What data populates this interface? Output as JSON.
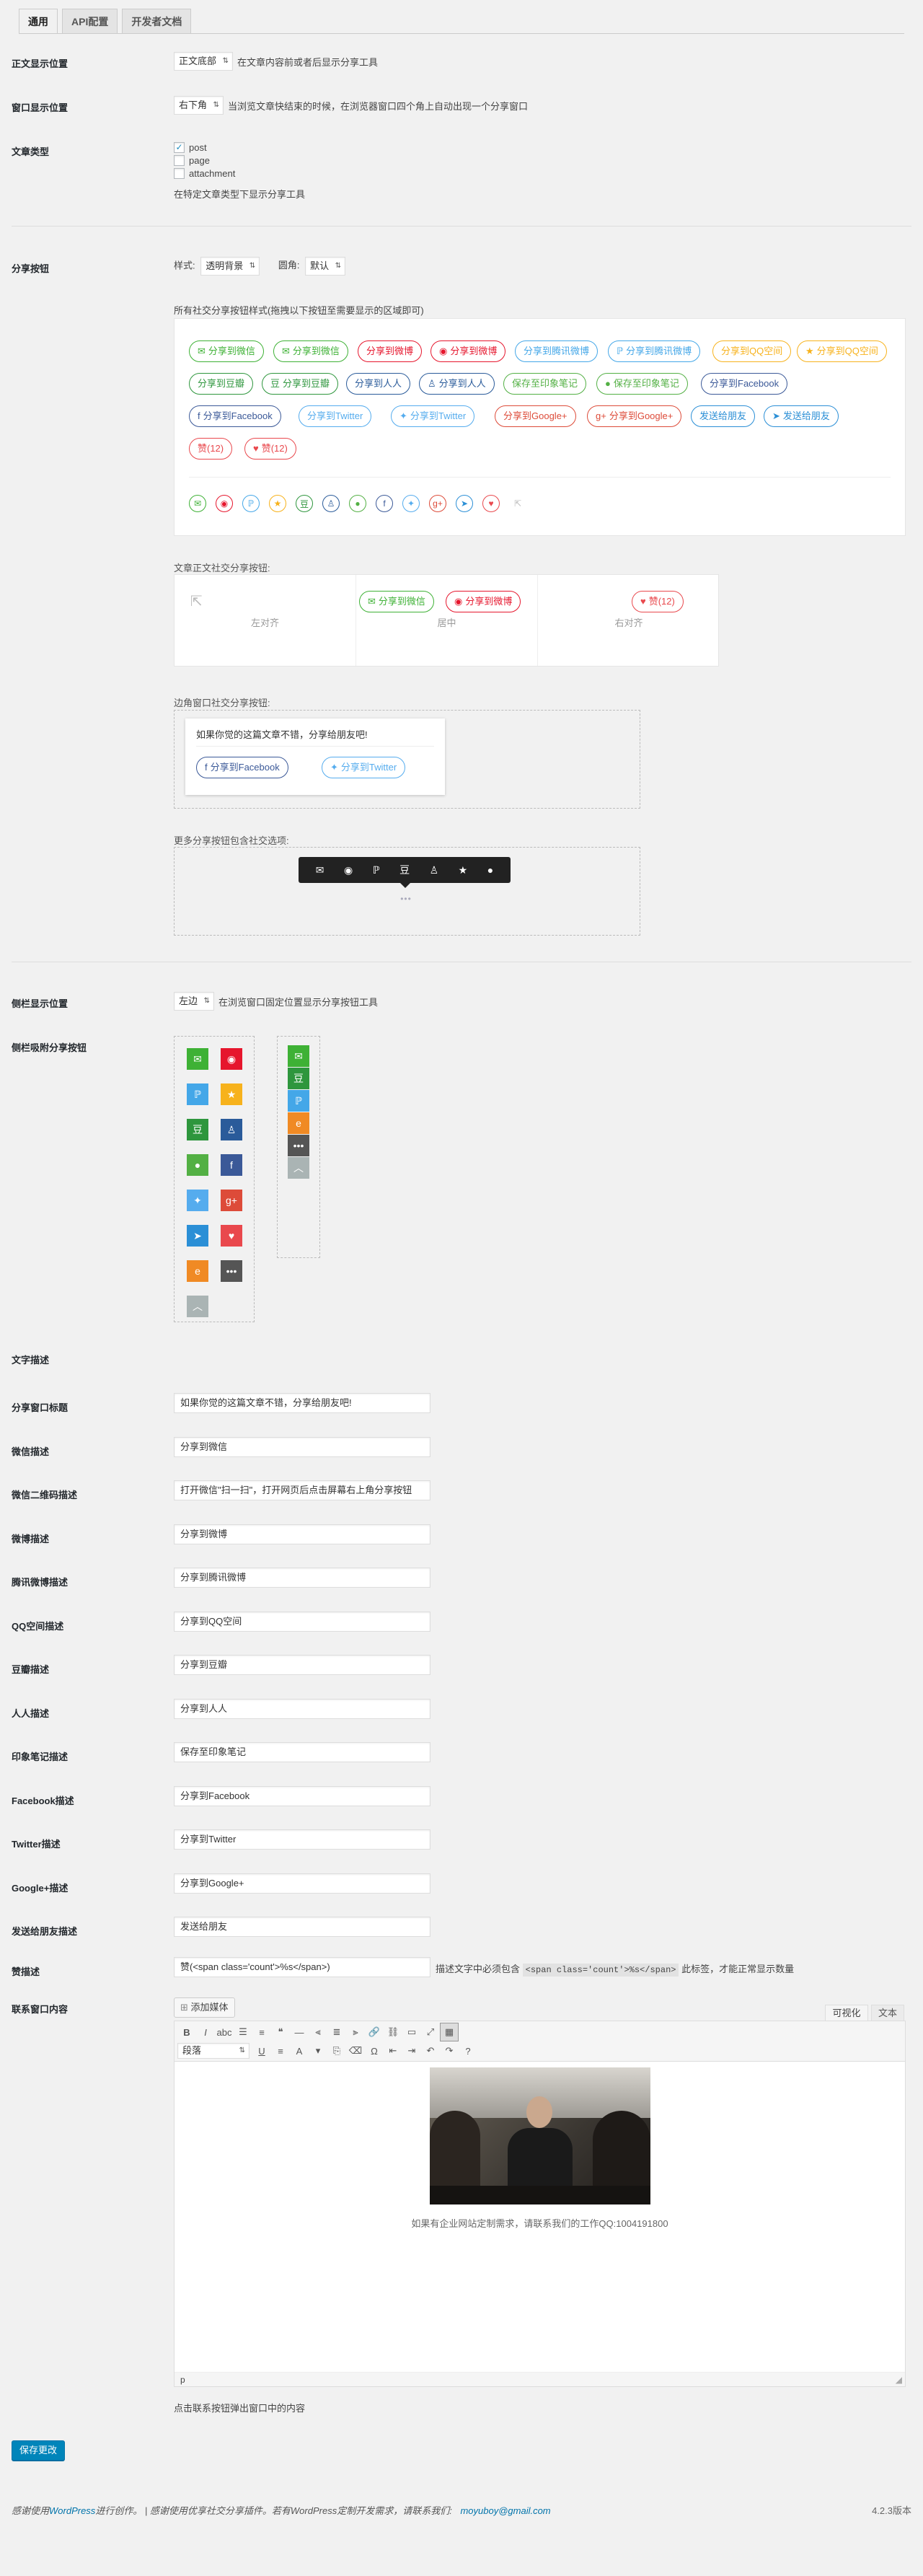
{
  "tabs": [
    "通用",
    "API配置",
    "开发者文档"
  ],
  "sections": {
    "position": {
      "label": "正文显示位置",
      "select": "正文底部",
      "hint": "在文章内容前或者后显示分享工具"
    },
    "window": {
      "label": "窗口显示位置",
      "select": "右下角",
      "hint": "当浏览文章快结束的时候，在浏览器窗口四个角上自动出现一个分享窗口"
    },
    "types": {
      "label": "文章类型",
      "items": [
        {
          "name": "post",
          "checked": "✓"
        },
        {
          "name": "page",
          "checked": ""
        },
        {
          "name": "attachment",
          "checked": ""
        }
      ],
      "hint": "在特定文章类型下显示分享工具"
    },
    "buttons": {
      "label": "分享按钮",
      "style_label": "样式:",
      "style_value": "透明背景",
      "corner_label": "圆角:",
      "corner_value": "默认",
      "note": "所有社交分享按钮样式(拖拽以下按钮至需要显示的区域即可)"
    },
    "article": {
      "caption": "文章正文社交分享按钮:",
      "left": "左对齐",
      "center": "居中",
      "right": "右对齐"
    },
    "corner": {
      "caption": "边角窗口社交分享按钮:",
      "text": "如果你觉的这篇文章不错，分享给朋友吧!"
    },
    "more": {
      "caption": "更多分享按钮包含社交选项:"
    },
    "side": {
      "label": "侧栏显示位置",
      "select": "左边",
      "hint": "在浏览窗口固定位置显示分享按钮工具"
    },
    "sidebtns": {
      "label": "侧栏吸附分享按钮"
    },
    "textdesc": {
      "label": "文字描述"
    }
  },
  "share_buttons": [
    {
      "t": "分享到微信",
      "c": "#3eb135",
      "i": "✉",
      "s": "o"
    },
    {
      "t": "分享到微信",
      "c": "#3eb135",
      "i": "✉",
      "s": "o"
    },
    {
      "t": "分享到微博",
      "c": "#e6162d",
      "i": "",
      "s": "o"
    },
    {
      "t": "分享到微博",
      "c": "#e6162d",
      "i": "◉",
      "s": "o"
    },
    {
      "t": "分享到腾讯微博",
      "c": "#44a7e8",
      "i": "",
      "s": "o"
    },
    {
      "t": "分享到腾讯微博",
      "c": "#44a7e8",
      "i": "ℙ",
      "s": "o"
    },
    {
      "t": "分享到QQ空间",
      "c": "#f7b21c",
      "i": "",
      "s": "o"
    },
    {
      "t": "分享到QQ空间",
      "c": "#f7b21c",
      "i": "★",
      "s": "o"
    },
    {
      "t": "分享到豆瓣",
      "c": "#2e963d",
      "i": "",
      "s": "o"
    },
    {
      "t": "分享到豆瓣",
      "c": "#2e963d",
      "i": "豆",
      "s": "o"
    },
    {
      "t": "分享到人人",
      "c": "#2a5b9a",
      "i": "",
      "s": "o"
    },
    {
      "t": "分享到人人",
      "c": "#2a5b9a",
      "i": "♙",
      "s": "o"
    },
    {
      "t": "保存至印象笔记",
      "c": "#53b044",
      "i": "",
      "s": "o"
    },
    {
      "t": "保存至印象笔记",
      "c": "#53b044",
      "i": "●",
      "s": "o"
    },
    {
      "t": "分享到Facebook",
      "c": "#3b5998",
      "i": "",
      "s": "o"
    },
    {
      "t": "分享到Facebook",
      "c": "#3b5998",
      "i": "f",
      "s": "o"
    },
    {
      "t": "分享到Twitter",
      "c": "#55acee",
      "i": "",
      "s": "o"
    },
    {
      "t": "分享到Twitter",
      "c": "#55acee",
      "i": "✦",
      "s": "o"
    },
    {
      "t": "分享到Google+",
      "c": "#dd4b39",
      "i": "",
      "s": "o"
    },
    {
      "t": "分享到Google+",
      "c": "#dd4b39",
      "i": "g+",
      "s": "o"
    },
    {
      "t": "发送给朋友",
      "c": "#2b8fd6",
      "i": "",
      "s": "o"
    },
    {
      "t": "发送给朋友",
      "c": "#2b8fd6",
      "i": "➤",
      "s": "o"
    },
    {
      "t": "赞(12)",
      "c": "#e9484d",
      "i": "",
      "s": "o"
    },
    {
      "t": "赞(12)",
      "c": "#e9484d",
      "i": "♥",
      "s": "o"
    }
  ],
  "icons": [
    {
      "c": "#3eb135",
      "i": "✉"
    },
    {
      "c": "#e6162d",
      "i": "◉"
    },
    {
      "c": "#44a7e8",
      "i": "ℙ"
    },
    {
      "c": "#f7b21c",
      "i": "★"
    },
    {
      "c": "#2e963d",
      "i": "豆"
    },
    {
      "c": "#2a5b9a",
      "i": "♙"
    },
    {
      "c": "#53b044",
      "i": "●"
    },
    {
      "c": "#3b5998",
      "i": "f"
    },
    {
      "c": "#55acee",
      "i": "✦"
    },
    {
      "c": "#dd4b39",
      "i": "g+"
    },
    {
      "c": "#2b8fd6",
      "i": "➤"
    },
    {
      "c": "#e9484d",
      "i": "♥"
    },
    {
      "c": "#bbbbbb",
      "i": "⇱"
    }
  ],
  "article_buttons": {
    "left_icon": "⇱",
    "wechat": "分享到微信",
    "weibo": "分享到微博",
    "like": "赞(12)"
  },
  "corner_buttons": {
    "facebook": "分享到Facebook",
    "twitter": "分享到Twitter"
  },
  "more_icons": [
    "✉",
    "◉",
    "ℙ",
    "豆",
    "♙",
    "★",
    "●"
  ],
  "more_dots": "•••",
  "side_tiles": [
    {
      "c": "#3eb135",
      "i": "✉"
    },
    {
      "c": "#e6162d",
      "i": "◉"
    },
    {
      "c": "#44a7e8",
      "i": "ℙ"
    },
    {
      "c": "#f7b21c",
      "i": "★"
    },
    {
      "c": "#2e963d",
      "i": "豆"
    },
    {
      "c": "#2a5b9a",
      "i": "♙"
    },
    {
      "c": "#53b044",
      "i": "●"
    },
    {
      "c": "#3b5998",
      "i": "f"
    },
    {
      "c": "#55acee",
      "i": "✦"
    },
    {
      "c": "#dd4b39",
      "i": "g+"
    },
    {
      "c": "#2b8fd6",
      "i": "➤"
    },
    {
      "c": "#e9484d",
      "i": "♥"
    },
    {
      "c": "#f08a24",
      "i": "e"
    },
    {
      "c": "#555555",
      "i": "•••"
    },
    {
      "c": "#aab4b4",
      "i": "︿"
    }
  ],
  "side_strip": [
    {
      "c": "#3eb135",
      "i": "✉"
    },
    {
      "c": "#2e963d",
      "i": "豆"
    },
    {
      "c": "#44a7e8",
      "i": "ℙ"
    },
    {
      "c": "#f08a24",
      "i": "e"
    },
    {
      "c": "#555555",
      "i": "•••"
    },
    {
      "c": "#aab4b4",
      "i": "︿"
    }
  ],
  "fields": [
    {
      "label": "分享窗口标题",
      "value": "如果你觉的这篇文章不错，分享给朋友吧!"
    },
    {
      "label": "微信描述",
      "value": "分享到微信"
    },
    {
      "label": "微信二维码描述",
      "value": "打开微信\"扫一扫\"，打开网页后点击屏幕右上角分享按钮"
    },
    {
      "label": "微博描述",
      "value": "分享到微博"
    },
    {
      "label": "腾讯微博描述",
      "value": "分享到腾讯微博"
    },
    {
      "label": "QQ空间描述",
      "value": "分享到QQ空间"
    },
    {
      "label": "豆瓣描述",
      "value": "分享到豆瓣"
    },
    {
      "label": "人人描述",
      "value": "分享到人人"
    },
    {
      "label": "印象笔记描述",
      "value": "保存至印象笔记"
    },
    {
      "label": "Facebook描述",
      "value": "分享到Facebook"
    },
    {
      "label": "Twitter描述",
      "value": "分享到Twitter"
    },
    {
      "label": "Google+描述",
      "value": "分享到Google+"
    },
    {
      "label": "发送给朋友描述",
      "value": "发送给朋友"
    }
  ],
  "like": {
    "label": "赞描述",
    "value": "赞(<span class='count'>%s</span>)",
    "hint_a": "描述文字中必须包含",
    "code": "<span class='count'>%s</span>",
    "hint_b": "此标签，才能正常显示数量"
  },
  "contact": {
    "label": "联系窗口内容",
    "add_media": "添加媒体",
    "tab_visual": "可视化",
    "tab_text": "文本",
    "format": "段落",
    "caption": "如果有企业网站定制需求，请联系我们的工作QQ:1004191800",
    "status": "p",
    "hint": "点击联系按钮弹出窗口中的内容"
  },
  "toolbar1": [
    "B",
    "I",
    "abc",
    "☰",
    "≡",
    "❝",
    "—",
    "⫷",
    "≣",
    "⫸",
    "🔗",
    "⛓",
    "▭",
    "⤢",
    "▦"
  ],
  "toolbar2": [
    "U",
    "≡",
    "A",
    "▾",
    "⎘",
    "⌫",
    "Ω",
    "⇤",
    "⇥",
    "↶",
    "↷",
    "?"
  ],
  "save": "保存更改",
  "footer": {
    "text_a": "感谢使用",
    "link": "WordPress",
    "text_b": "进行创作。 | 感谢使用优享社交分享插件。若有WordPress定制开发需求，请联系我们:",
    "email": "moyuboy@gmail.com",
    "version": "4.2.3版本"
  }
}
